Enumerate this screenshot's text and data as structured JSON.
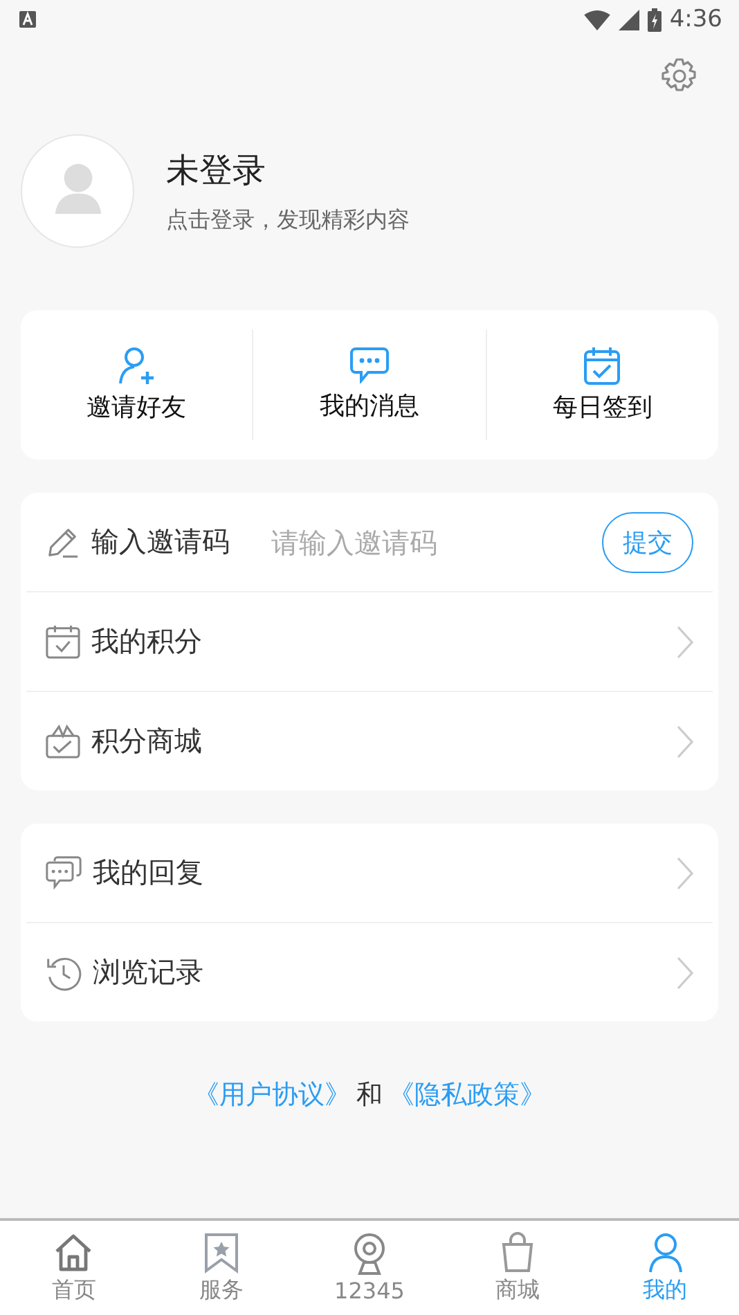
{
  "status_bar": {
    "time": "4:36"
  },
  "profile": {
    "name": "未登录",
    "hint": "点击登录，发现精彩内容"
  },
  "quick_actions": [
    {
      "label": "邀请好友",
      "kind": "invite"
    },
    {
      "label": "我的消息",
      "kind": "message"
    },
    {
      "label": "每日签到",
      "kind": "checkin"
    }
  ],
  "invite_code": {
    "label": "输入邀请码",
    "placeholder": "请输入邀请码",
    "button": "提交"
  },
  "menu_groups": [
    [
      {
        "label": "我的积分",
        "kind": "points"
      },
      {
        "label": "积分商城",
        "kind": "mall"
      }
    ],
    [
      {
        "label": "我的回复",
        "kind": "reply"
      },
      {
        "label": "浏览记录",
        "kind": "history"
      }
    ]
  ],
  "footer": {
    "links": [
      "《用户协议》",
      "《隐私政策》"
    ],
    "joiner": "和"
  },
  "tab_bar": [
    {
      "label": "首页",
      "kind": "home",
      "selected": false
    },
    {
      "label": "服务",
      "kind": "service",
      "selected": false
    },
    {
      "label": "12345",
      "kind": "camera",
      "selected": false
    },
    {
      "label": "商城",
      "kind": "shop",
      "selected": false
    },
    {
      "label": "我的",
      "kind": "me",
      "selected": true
    }
  ]
}
